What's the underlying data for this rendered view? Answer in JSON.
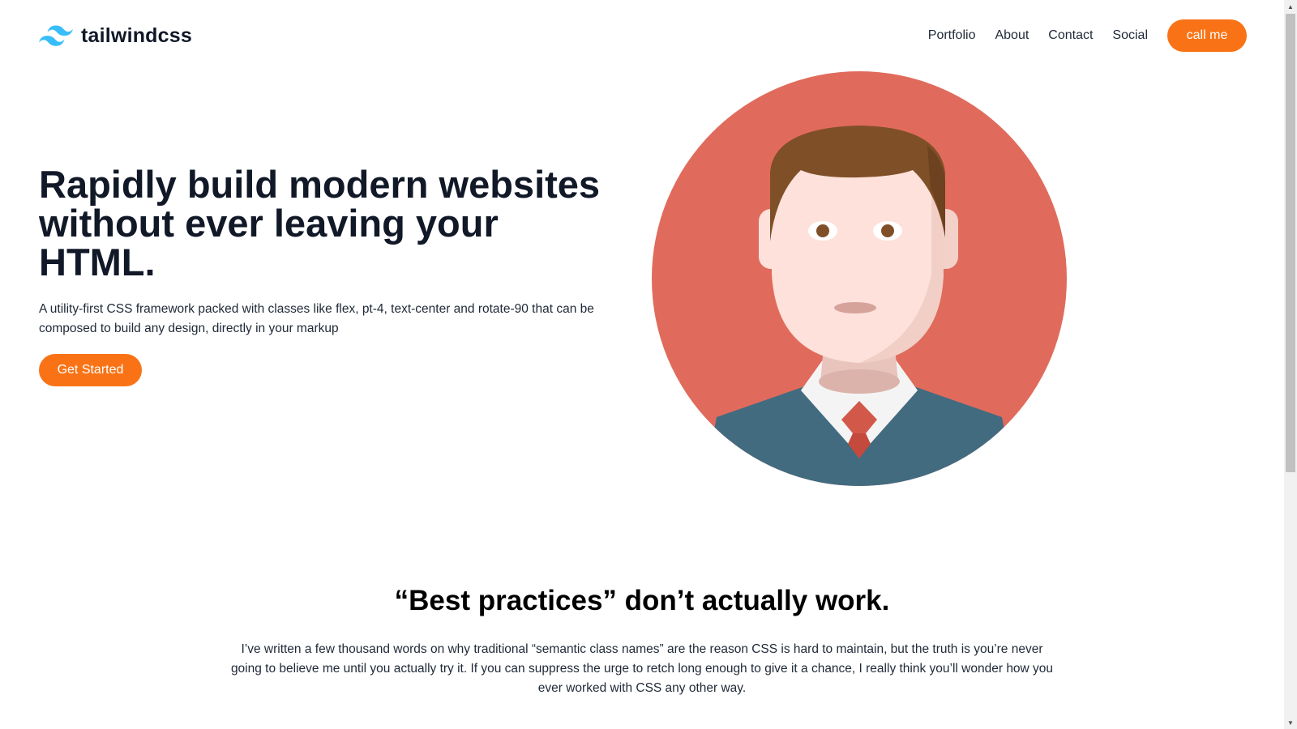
{
  "header": {
    "brand_name": "tailwindcss",
    "logo_icon": "tailwind-wave-logo",
    "nav": [
      {
        "label": "Portfolio"
      },
      {
        "label": "About"
      },
      {
        "label": "Contact"
      },
      {
        "label": "Social"
      }
    ],
    "cta_label": "call me"
  },
  "hero": {
    "title": "Rapidly build modern websites without ever leaving your HTML.",
    "description": "A utility-first CSS framework packed with classes like flex, pt-4, text-center and rotate-90 that can be composed to build any design, directly in your markup",
    "button_label": "Get Started",
    "illustration": "businessman-avatar"
  },
  "section": {
    "title": "“Best practices” don’t actually work.",
    "text": "I’ve written a few thousand words on why traditional “semantic class names” are the reason CSS is hard to maintain, but the truth is you’re never going to believe me until you actually try it. If you can suppress the urge to retch long enough to give it a chance, I really think you’ll wonder how you ever worked with CSS any other way."
  },
  "colors": {
    "accent": "#f97316",
    "logo": "#38bdf8",
    "avatar_bg": "#e06b5c",
    "suit": "#426b80",
    "hair": "#7f4f27",
    "skin": "#fde1da",
    "tie": "#d2594a"
  }
}
